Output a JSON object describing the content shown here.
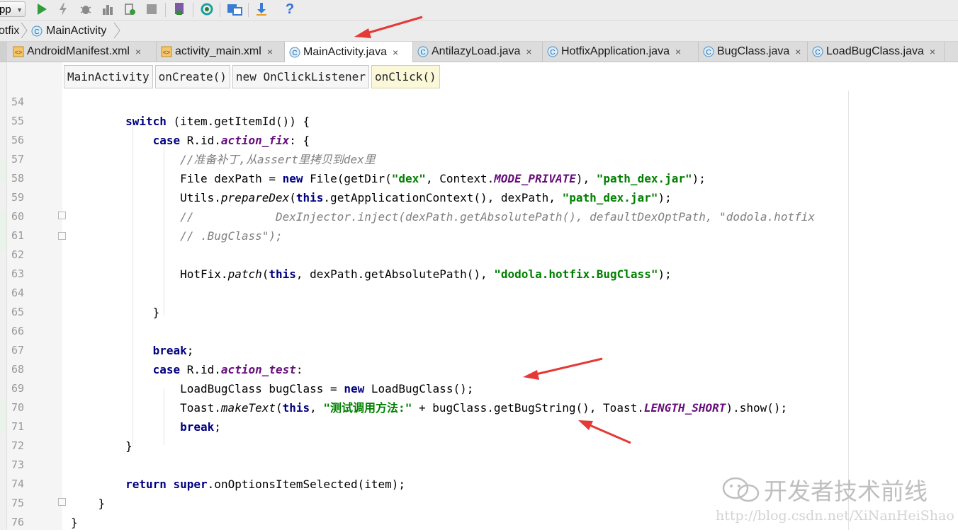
{
  "toolbar": {
    "run_config": "pp",
    "buttons": [
      "run-icon",
      "lightning-icon",
      "debug-icon",
      "attach-icon",
      "coverage-icon",
      "stop-icon",
      "sdk-manager-icon",
      "sync-icon",
      "project-structure-icon",
      "download-icon",
      "help-icon"
    ]
  },
  "breadcrumb": [
    "otfix",
    "MainActivity"
  ],
  "tabs": [
    {
      "label": "AndroidManifest.xml",
      "icon": "xml-file-icon",
      "close": "×"
    },
    {
      "label": "activity_main.xml",
      "icon": "xml-file-icon",
      "close": "×"
    },
    {
      "label": "MainActivity.java",
      "icon": "class-icon",
      "close": "×"
    },
    {
      "label": "AntilazyLoad.java",
      "icon": "class-icon",
      "close": "×"
    },
    {
      "label": "HotfixApplication.java",
      "icon": "class-icon",
      "close": "×"
    },
    {
      "label": "BugClass.java",
      "icon": "class-icon",
      "close": "×"
    },
    {
      "label": "LoadBugClass.java",
      "icon": "class-icon",
      "close": "×"
    }
  ],
  "scope": [
    "MainActivity",
    "onCreate()",
    "new OnClickListener",
    "onClick()"
  ],
  "code": [
    {
      "n": "54",
      "segs": []
    },
    {
      "n": "55",
      "segs": [
        {
          "t": "        "
        },
        {
          "t": "switch",
          "c": "kw"
        },
        {
          "t": " (item.getItemId()) {"
        }
      ]
    },
    {
      "n": "56",
      "segs": [
        {
          "t": "            "
        },
        {
          "t": "case",
          "c": "kw"
        },
        {
          "t": " R.id."
        },
        {
          "t": "action_fix",
          "c": "fld"
        },
        {
          "t": ": {"
        }
      ]
    },
    {
      "n": "57",
      "segs": [
        {
          "t": "                "
        },
        {
          "t": "//准备补丁,从assert里拷贝到dex里",
          "c": "cmt"
        }
      ]
    },
    {
      "n": "58",
      "segs": [
        {
          "t": "                File dexPath = "
        },
        {
          "t": "new",
          "c": "kw"
        },
        {
          "t": " File(getDir("
        },
        {
          "t": "\"dex\"",
          "c": "str"
        },
        {
          "t": ", Context."
        },
        {
          "t": "MODE_PRIVATE",
          "c": "fld"
        },
        {
          "t": "), "
        },
        {
          "t": "\"path_dex.jar\"",
          "c": "str"
        },
        {
          "t": ");"
        }
      ]
    },
    {
      "n": "59",
      "segs": [
        {
          "t": "                Utils."
        },
        {
          "t": "prepareDex",
          "c": "it"
        },
        {
          "t": "("
        },
        {
          "t": "this",
          "c": "kw"
        },
        {
          "t": ".getApplicationContext(), dexPath, "
        },
        {
          "t": "\"path_dex.jar\"",
          "c": "str"
        },
        {
          "t": ");"
        }
      ]
    },
    {
      "n": "60",
      "segs": [
        {
          "t": "                "
        },
        {
          "t": "//            DexInjector.inject(dexPath.getAbsolutePath(), defaultDexOptPath, \"dodola.hotfix",
          "c": "cmt"
        }
      ]
    },
    {
      "n": "61",
      "segs": [
        {
          "t": "                "
        },
        {
          "t": "// .BugClass\");",
          "c": "cmt"
        }
      ]
    },
    {
      "n": "62",
      "segs": []
    },
    {
      "n": "63",
      "segs": [
        {
          "t": "                HotFix."
        },
        {
          "t": "patch",
          "c": "it"
        },
        {
          "t": "("
        },
        {
          "t": "this",
          "c": "kw"
        },
        {
          "t": ", dexPath.getAbsolutePath(), "
        },
        {
          "t": "\"dodola.hotfix.BugClass\"",
          "c": "str"
        },
        {
          "t": ");"
        }
      ]
    },
    {
      "n": "64",
      "segs": []
    },
    {
      "n": "65",
      "segs": [
        {
          "t": "            }"
        }
      ]
    },
    {
      "n": "66",
      "segs": []
    },
    {
      "n": "67",
      "segs": [
        {
          "t": "            "
        },
        {
          "t": "break",
          "c": "kw"
        },
        {
          "t": ";"
        }
      ]
    },
    {
      "n": "68",
      "segs": [
        {
          "t": "            "
        },
        {
          "t": "case",
          "c": "kw"
        },
        {
          "t": " R.id."
        },
        {
          "t": "action_test",
          "c": "fld"
        },
        {
          "t": ":"
        }
      ]
    },
    {
      "n": "69",
      "segs": [
        {
          "t": "                LoadBugClass bugClass = "
        },
        {
          "t": "new",
          "c": "kw"
        },
        {
          "t": " LoadBugClass();"
        }
      ]
    },
    {
      "n": "70",
      "segs": [
        {
          "t": "                Toast."
        },
        {
          "t": "makeText",
          "c": "it"
        },
        {
          "t": "("
        },
        {
          "t": "this",
          "c": "kw"
        },
        {
          "t": ", "
        },
        {
          "t": "\"测试调用方法:\"",
          "c": "str"
        },
        {
          "t": " + bugClass.getBugString(), Toast."
        },
        {
          "t": "LENGTH_SHORT",
          "c": "fld"
        },
        {
          "t": ").show();"
        }
      ]
    },
    {
      "n": "71",
      "segs": [
        {
          "t": "                "
        },
        {
          "t": "break",
          "c": "kw"
        },
        {
          "t": ";"
        }
      ]
    },
    {
      "n": "72",
      "segs": [
        {
          "t": "        }"
        }
      ]
    },
    {
      "n": "73",
      "segs": []
    },
    {
      "n": "74",
      "segs": [
        {
          "t": "        "
        },
        {
          "t": "return",
          "c": "kw"
        },
        {
          "t": " "
        },
        {
          "t": "super",
          "c": "kw"
        },
        {
          "t": ".onOptionsItemSelected(item);"
        }
      ]
    },
    {
      "n": "75",
      "segs": [
        {
          "t": "    }"
        }
      ]
    },
    {
      "n": "76",
      "segs": [
        {
          "t": "}"
        }
      ]
    }
  ],
  "watermark": {
    "title": "开发者技术前线",
    "url": "http://blog.csdn.net/XiNanHeiShao"
  },
  "colors": {
    "keyword": "#000080",
    "string": "#008000",
    "field": "#660e7a",
    "comment": "#808080",
    "annotation_arrow": "#e53935"
  }
}
